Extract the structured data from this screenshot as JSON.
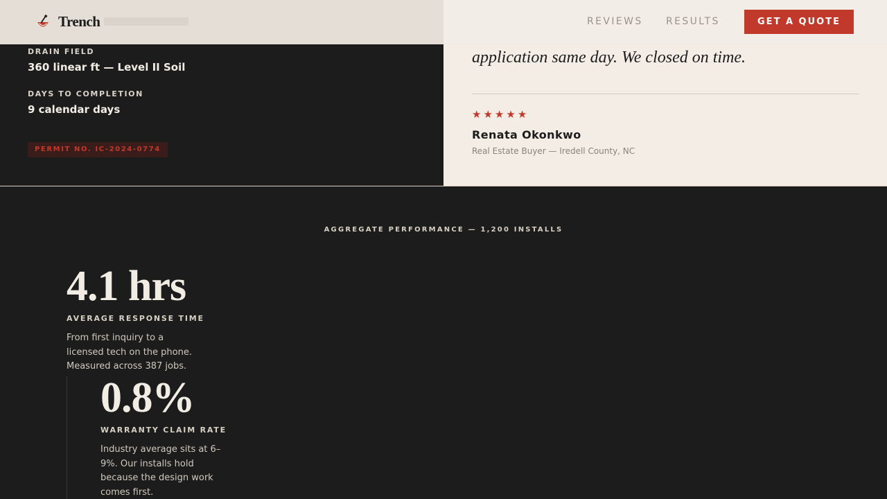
{
  "header": {
    "logo_text": "Trench",
    "nav": [
      "REVIEWS",
      "RESULTS"
    ],
    "cta_label": "GET A QUOTE"
  },
  "project_specs": [
    {
      "label": "DRAIN FIELD",
      "value": "360 linear ft — Level II Soil"
    },
    {
      "label": "DAYS TO COMPLETION",
      "value": "9 calendar days"
    }
  ],
  "permit_badge": "PERMIT NO. IC-2024-0774",
  "testimonial": {
    "quote_visible_line": "application same day. We closed on time.",
    "rating": 5,
    "rating_max": 5,
    "reviewer_name": "Renata Okonkwo",
    "reviewer_meta": "Real Estate Buyer — Iredell County, NC"
  },
  "aggregate": {
    "eyebrow": "AGGREGATE PERFORMANCE — 1,200 INSTALLS",
    "stats": [
      {
        "number": "4.1 hrs",
        "label": "AVERAGE RESPONSE TIME",
        "desc": [
          "From first inquiry to a",
          "licensed tech on the phone.",
          "Measured across 387 jobs."
        ]
      },
      {
        "number": "0.8%",
        "label": "WARRANTY CLAIM RATE",
        "desc": [
          "Industry average sits at 6–",
          "9%. Our installs hold",
          "because the design work",
          "comes first."
        ]
      }
    ]
  },
  "colors": {
    "accent": "#c0392b",
    "dark_bg": "#1c1c1c",
    "cream_bg": "#f3ede6"
  }
}
